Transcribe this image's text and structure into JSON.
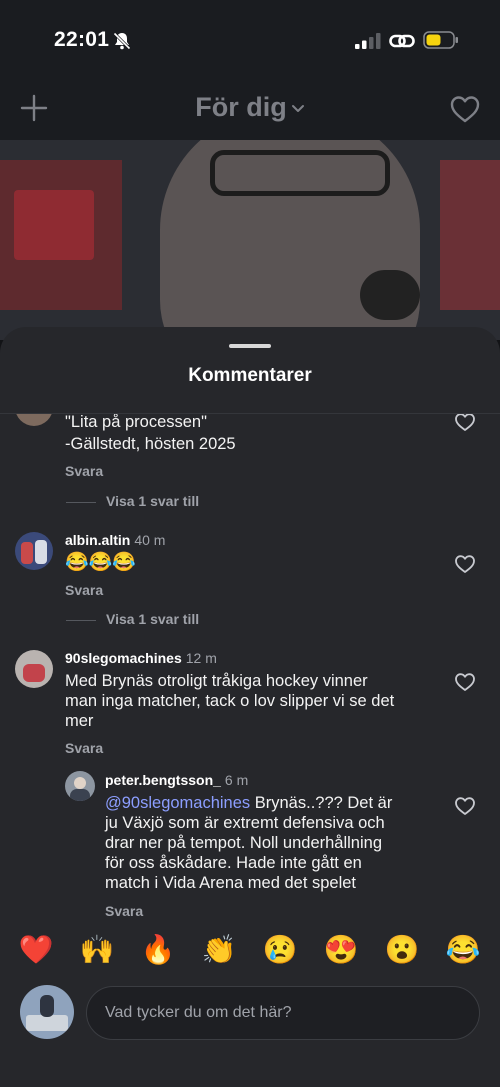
{
  "status_bar": {
    "time": "22:01"
  },
  "header": {
    "feed_title": "För dig"
  },
  "sheet": {
    "title": "Kommentarer"
  },
  "comments": [
    {
      "text_lines": [
        "\"Lita på processen\"",
        "-Gällstedt, hösten 2025"
      ],
      "reply_label": "Svara",
      "more_replies": "Visa 1 svar till"
    },
    {
      "username": "albin.altin",
      "time": "40 m",
      "text": "😂😂😂",
      "reply_label": "Svara",
      "more_replies": "Visa 1 svar till"
    },
    {
      "username": "90slegomachines",
      "time": "12 m",
      "text_lines": [
        "Med Brynäs otroligt tråkiga hockey vinner",
        "man inga matcher, tack o lov slipper vi se det",
        "mer"
      ],
      "reply_label": "Svara",
      "replies": [
        {
          "username": "peter.bengtsson_",
          "time": "6 m",
          "mention": "@90slegomachines",
          "text_first": " Brynäs..??? Det är",
          "text_lines": [
            "ju Växjö som är extremt defensiva och",
            "drar ner på tempot. Noll underhållning",
            "för oss åskådare. Hade inte gått en",
            "match i Vida Arena med det spelet"
          ],
          "reply_label": "Svara"
        }
      ]
    }
  ],
  "emoji_bar": [
    "❤️",
    "🙌",
    "🔥",
    "👏",
    "😢",
    "😍",
    "😮",
    "😂"
  ],
  "composer": {
    "placeholder": "Vad tycker du om det här?"
  },
  "colors": {
    "background": "#121316",
    "sheet": "#26272b",
    "mention": "#8c9eff",
    "battery": "#f5d30f"
  }
}
